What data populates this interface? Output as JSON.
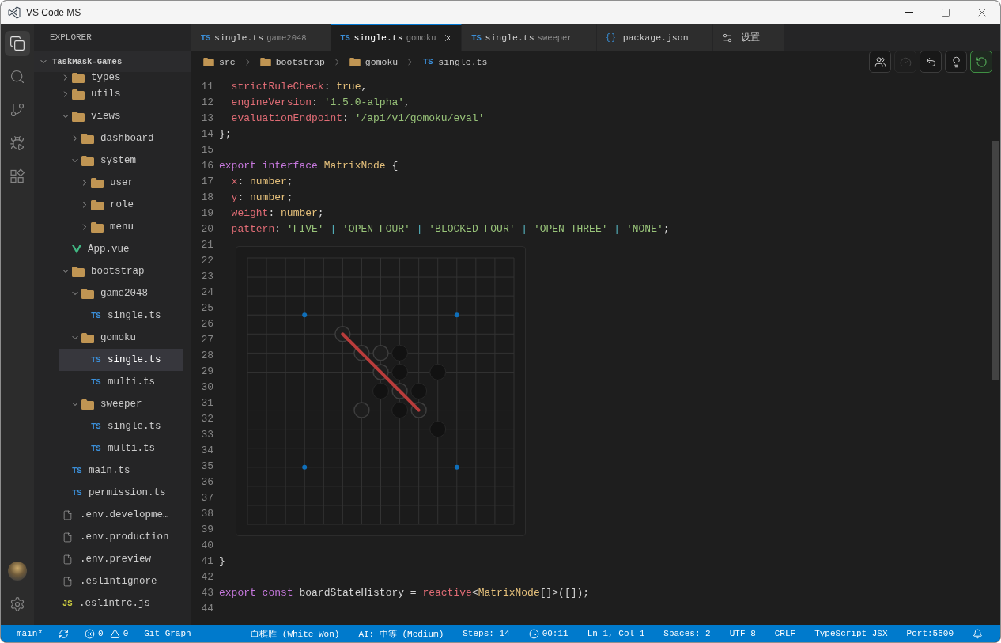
{
  "window": {
    "title": "VS Code MS"
  },
  "activity_bar": {
    "items": [
      {
        "kind": "explorer",
        "selected": true
      },
      {
        "kind": "search",
        "selected": false
      },
      {
        "kind": "source_control",
        "selected": false
      },
      {
        "kind": "run_debug",
        "selected": false
      },
      {
        "kind": "extensions",
        "selected": false
      }
    ],
    "bottom": [
      {
        "kind": "account"
      },
      {
        "kind": "settings"
      }
    ]
  },
  "explorer": {
    "title": "EXPLORER",
    "root": {
      "label": "TaskMask-Games",
      "expanded": true
    },
    "tree": [
      {
        "children": [
          {
            "label": "types",
            "kind": "folder",
            "expanded": false,
            "selected": false
          },
          {
            "label": "utils",
            "kind": "folder",
            "expanded": false,
            "selected": false
          },
          {
            "label": "views",
            "kind": "folder",
            "expanded": true,
            "selected": false,
            "children": [
              {
                "label": "dashboard",
                "kind": "folder",
                "expanded": false,
                "selected": false
              },
              {
                "label": "system",
                "kind": "folder",
                "expanded": true,
                "selected": false,
                "children": [
                  {
                    "label": "user",
                    "kind": "folder",
                    "expanded": false,
                    "selected": false
                  },
                  {
                    "label": "role",
                    "kind": "folder",
                    "expanded": false,
                    "selected": false
                  },
                  {
                    "label": "menu",
                    "kind": "folder",
                    "expanded": false,
                    "selected": false
                  }
                ]
              }
            ]
          },
          {
            "label": "App.vue",
            "kind": "vue",
            "selected": false
          },
          {
            "label": "bootstrap",
            "kind": "folder",
            "expanded": true,
            "selected": false,
            "children": [
              {
                "label": "game2048",
                "kind": "folder",
                "expanded": true,
                "selected": false,
                "children": [
                  {
                    "label": "single.ts",
                    "kind": "ts",
                    "badge": "TS",
                    "selected": false
                  }
                ]
              },
              {
                "label": "gomoku",
                "kind": "folder",
                "expanded": true,
                "selected": false,
                "children": [
                  {
                    "label": "single.ts",
                    "kind": "ts",
                    "badge": "TS",
                    "selected": true
                  },
                  {
                    "label": "multi.ts",
                    "kind": "ts",
                    "badge": "TS",
                    "selected": false
                  }
                ]
              },
              {
                "label": "sweeper",
                "kind": "folder",
                "expanded": true,
                "selected": false,
                "children": [
                  {
                    "label": "single.ts",
                    "kind": "ts",
                    "badge": "TS",
                    "selected": false
                  },
                  {
                    "label": "multi.ts",
                    "kind": "ts",
                    "badge": "TS",
                    "selected": false
                  }
                ]
              }
            ]
          },
          {
            "label": "main.ts",
            "kind": "ts",
            "badge": "TS",
            "selected": false
          },
          {
            "label": "permission.ts",
            "kind": "ts",
            "badge": "TS",
            "selected": false
          }
        ]
      },
      {
        "label": ".env.developme…",
        "kind": "file",
        "selected": false
      },
      {
        "label": ".env.production",
        "kind": "file",
        "selected": false
      },
      {
        "label": ".env.preview",
        "kind": "file",
        "selected": false
      },
      {
        "label": ".eslintignore",
        "kind": "file",
        "selected": false
      },
      {
        "label": ".eslintrc.js",
        "kind": "js",
        "badge": "JS",
        "selected": false
      }
    ]
  },
  "tabs": [
    {
      "kind": "ts",
      "badge": "TS",
      "label": "single.ts",
      "description": "game2048",
      "selected": false
    },
    {
      "kind": "ts",
      "badge": "TS",
      "label": "single.ts",
      "description": "gomoku",
      "selected": true
    },
    {
      "kind": "ts",
      "badge": "TS",
      "label": "single.ts",
      "description": "sweeper",
      "selected": false
    },
    {
      "kind": "json",
      "label": "package.json",
      "selected": false
    },
    {
      "kind": "settings",
      "label": "设置",
      "selected": false
    }
  ],
  "breadcrumb": [
    {
      "kind": "folder",
      "label": "src"
    },
    {
      "kind": "folder",
      "label": "bootstrap"
    },
    {
      "kind": "folder",
      "label": "gomoku"
    },
    {
      "kind": "ts",
      "badge": "TS",
      "label": "single.ts"
    }
  ],
  "toolbar": [
    {
      "kind": "players",
      "disabled": false,
      "active": false
    },
    {
      "kind": "speed",
      "disabled": true,
      "active": false
    },
    {
      "kind": "undo",
      "disabled": false,
      "active": false
    },
    {
      "kind": "hint",
      "disabled": false,
      "active": false
    },
    {
      "kind": "restart",
      "disabled": false,
      "active": true
    }
  ],
  "editor": {
    "lines": [
      {
        "number": "11",
        "tokens": [
          {
            "text": "  strictRuleCheck",
            "kind": "property"
          },
          {
            "text": ": ",
            "kind": "punct"
          },
          {
            "text": "true",
            "kind": "boolean"
          },
          {
            "text": ",",
            "kind": "punct"
          }
        ]
      },
      {
        "number": "12",
        "tokens": [
          {
            "text": "  engineVersion",
            "kind": "property"
          },
          {
            "text": ": ",
            "kind": "punct"
          },
          {
            "text": "'1.5.0-alpha'",
            "kind": "string"
          },
          {
            "text": ",",
            "kind": "punct"
          }
        ]
      },
      {
        "number": "13",
        "tokens": [
          {
            "text": "  evaluationEndpoint",
            "kind": "property"
          },
          {
            "text": ": ",
            "kind": "punct"
          },
          {
            "text": "'/api/v1/gomoku/eval'",
            "kind": "string"
          }
        ]
      },
      {
        "number": "14",
        "tokens": [
          {
            "text": "};",
            "kind": "punct"
          }
        ]
      },
      {
        "number": "15"
      },
      {
        "number": "16",
        "tokens": [
          {
            "text": "export interface",
            "kind": "keyword"
          },
          {
            "text": " MatrixNode",
            "kind": "type"
          },
          {
            "text": " {",
            "kind": "punct"
          }
        ]
      },
      {
        "number": "17",
        "tokens": [
          {
            "text": "  x",
            "kind": "property"
          },
          {
            "text": ": ",
            "kind": "punct"
          },
          {
            "text": "number",
            "kind": "type"
          },
          {
            "text": ";",
            "kind": "punct"
          }
        ]
      },
      {
        "number": "18",
        "tokens": [
          {
            "text": "  y",
            "kind": "property"
          },
          {
            "text": ": ",
            "kind": "punct"
          },
          {
            "text": "number",
            "kind": "type"
          },
          {
            "text": ";",
            "kind": "punct"
          }
        ]
      },
      {
        "number": "19",
        "tokens": [
          {
            "text": "  weight",
            "kind": "property"
          },
          {
            "text": ": ",
            "kind": "punct"
          },
          {
            "text": "number",
            "kind": "type"
          },
          {
            "text": ";",
            "kind": "punct"
          }
        ]
      },
      {
        "number": "20",
        "tokens": [
          {
            "text": "  pattern",
            "kind": "property"
          },
          {
            "text": ": ",
            "kind": "punct"
          },
          {
            "text": "'FIVE'",
            "kind": "string"
          },
          {
            "text": " | ",
            "kind": "operator"
          },
          {
            "text": "'OPEN_FOUR'",
            "kind": "string"
          },
          {
            "text": " | ",
            "kind": "operator"
          },
          {
            "text": "'BLOCKED_FOUR'",
            "kind": "string"
          },
          {
            "text": " | ",
            "kind": "operator"
          },
          {
            "text": "'OPEN_THREE'",
            "kind": "string"
          },
          {
            "text": " | ",
            "kind": "operator"
          },
          {
            "text": "'NONE'",
            "kind": "string"
          },
          {
            "text": ";",
            "kind": "punct"
          }
        ]
      },
      {
        "number": "21",
        "board": {
          "rows": [
            [
              {
                "kind": "empty"
              },
              {
                "kind": "empty"
              },
              {
                "kind": "empty"
              },
              {
                "kind": "empty"
              },
              {
                "kind": "empty"
              },
              {
                "kind": "empty"
              },
              {
                "kind": "empty"
              },
              {
                "kind": "empty"
              },
              {
                "kind": "empty"
              },
              {
                "kind": "empty"
              },
              {
                "kind": "empty"
              },
              {
                "kind": "empty"
              },
              {
                "kind": "empty"
              },
              {
                "kind": "empty"
              },
              {
                "kind": "empty"
              }
            ],
            [
              {
                "kind": "empty"
              },
              {
                "kind": "empty"
              },
              {
                "kind": "empty"
              },
              {
                "kind": "empty"
              },
              {
                "kind": "empty"
              },
              {
                "kind": "empty"
              },
              {
                "kind": "empty"
              },
              {
                "kind": "empty"
              },
              {
                "kind": "empty"
              },
              {
                "kind": "empty"
              },
              {
                "kind": "empty"
              },
              {
                "kind": "empty"
              },
              {
                "kind": "empty"
              },
              {
                "kind": "empty"
              },
              {
                "kind": "empty"
              }
            ],
            [
              {
                "kind": "empty"
              },
              {
                "kind": "empty"
              },
              {
                "kind": "empty"
              },
              {
                "kind": "empty"
              },
              {
                "kind": "empty"
              },
              {
                "kind": "empty"
              },
              {
                "kind": "empty"
              },
              {
                "kind": "empty"
              },
              {
                "kind": "empty"
              },
              {
                "kind": "empty"
              },
              {
                "kind": "empty"
              },
              {
                "kind": "empty"
              },
              {
                "kind": "empty"
              },
              {
                "kind": "empty"
              },
              {
                "kind": "empty"
              }
            ],
            [
              {
                "kind": "empty"
              },
              {
                "kind": "empty"
              },
              {
                "kind": "empty"
              },
              {
                "kind": "empty"
              },
              {
                "kind": "empty"
              },
              {
                "kind": "empty"
              },
              {
                "kind": "empty"
              },
              {
                "kind": "empty"
              },
              {
                "kind": "empty"
              },
              {
                "kind": "empty"
              },
              {
                "kind": "empty"
              },
              {
                "kind": "empty"
              },
              {
                "kind": "empty"
              },
              {
                "kind": "empty"
              },
              {
                "kind": "empty"
              }
            ],
            [
              {
                "kind": "empty"
              },
              {
                "kind": "empty"
              },
              {
                "kind": "empty"
              },
              {
                "kind": "empty"
              },
              {
                "kind": "empty"
              },
              {
                "kind": "white",
                "winning": true
              },
              {
                "kind": "empty"
              },
              {
                "kind": "empty"
              },
              {
                "kind": "empty"
              },
              {
                "kind": "empty"
              },
              {
                "kind": "empty"
              },
              {
                "kind": "empty"
              },
              {
                "kind": "empty"
              },
              {
                "kind": "empty"
              },
              {
                "kind": "empty"
              }
            ],
            [
              {
                "kind": "empty"
              },
              {
                "kind": "empty"
              },
              {
                "kind": "empty"
              },
              {
                "kind": "empty"
              },
              {
                "kind": "empty"
              },
              {
                "kind": "empty"
              },
              {
                "kind": "white",
                "winning": true
              },
              {
                "kind": "white",
                "winning": false
              },
              {
                "kind": "black",
                "winning": false
              },
              {
                "kind": "empty"
              },
              {
                "kind": "empty"
              },
              {
                "kind": "empty"
              },
              {
                "kind": "empty"
              },
              {
                "kind": "empty"
              },
              {
                "kind": "empty"
              }
            ],
            [
              {
                "kind": "empty"
              },
              {
                "kind": "empty"
              },
              {
                "kind": "empty"
              },
              {
                "kind": "empty"
              },
              {
                "kind": "empty"
              },
              {
                "kind": "empty"
              },
              {
                "kind": "empty"
              },
              {
                "kind": "white",
                "winning": true
              },
              {
                "kind": "black",
                "winning": false
              },
              {
                "kind": "empty"
              },
              {
                "kind": "black",
                "winning": false
              },
              {
                "kind": "empty"
              },
              {
                "kind": "empty"
              },
              {
                "kind": "empty"
              },
              {
                "kind": "empty"
              }
            ],
            [
              {
                "kind": "empty"
              },
              {
                "kind": "empty"
              },
              {
                "kind": "empty"
              },
              {
                "kind": "empty"
              },
              {
                "kind": "empty"
              },
              {
                "kind": "empty"
              },
              {
                "kind": "empty"
              },
              {
                "kind": "black",
                "winning": false
              },
              {
                "kind": "white",
                "winning": true
              },
              {
                "kind": "black",
                "winning": false
              },
              {
                "kind": "empty"
              },
              {
                "kind": "empty"
              },
              {
                "kind": "empty"
              },
              {
                "kind": "empty"
              },
              {
                "kind": "empty"
              }
            ],
            [
              {
                "kind": "empty"
              },
              {
                "kind": "empty"
              },
              {
                "kind": "empty"
              },
              {
                "kind": "empty"
              },
              {
                "kind": "empty"
              },
              {
                "kind": "empty"
              },
              {
                "kind": "white",
                "winning": false
              },
              {
                "kind": "empty"
              },
              {
                "kind": "black",
                "winning": false
              },
              {
                "kind": "white",
                "winning": true
              },
              {
                "kind": "empty"
              },
              {
                "kind": "empty"
              },
              {
                "kind": "empty"
              },
              {
                "kind": "empty"
              },
              {
                "kind": "empty"
              }
            ],
            [
              {
                "kind": "empty"
              },
              {
                "kind": "empty"
              },
              {
                "kind": "empty"
              },
              {
                "kind": "empty"
              },
              {
                "kind": "empty"
              },
              {
                "kind": "empty"
              },
              {
                "kind": "empty"
              },
              {
                "kind": "empty"
              },
              {
                "kind": "empty"
              },
              {
                "kind": "empty"
              },
              {
                "kind": "black",
                "winning": false
              },
              {
                "kind": "empty"
              },
              {
                "kind": "empty"
              },
              {
                "kind": "empty"
              },
              {
                "kind": "empty"
              }
            ],
            [
              {
                "kind": "empty"
              },
              {
                "kind": "empty"
              },
              {
                "kind": "empty"
              },
              {
                "kind": "empty"
              },
              {
                "kind": "empty"
              },
              {
                "kind": "empty"
              },
              {
                "kind": "empty"
              },
              {
                "kind": "empty"
              },
              {
                "kind": "empty"
              },
              {
                "kind": "empty"
              },
              {
                "kind": "empty"
              },
              {
                "kind": "empty"
              },
              {
                "kind": "empty"
              },
              {
                "kind": "empty"
              },
              {
                "kind": "empty"
              }
            ],
            [
              {
                "kind": "empty"
              },
              {
                "kind": "empty"
              },
              {
                "kind": "empty"
              },
              {
                "kind": "empty"
              },
              {
                "kind": "empty"
              },
              {
                "kind": "empty"
              },
              {
                "kind": "empty"
              },
              {
                "kind": "empty"
              },
              {
                "kind": "empty"
              },
              {
                "kind": "empty"
              },
              {
                "kind": "empty"
              },
              {
                "kind": "empty"
              },
              {
                "kind": "empty"
              },
              {
                "kind": "empty"
              },
              {
                "kind": "empty"
              }
            ],
            [
              {
                "kind": "empty"
              },
              {
                "kind": "empty"
              },
              {
                "kind": "empty"
              },
              {
                "kind": "empty"
              },
              {
                "kind": "empty"
              },
              {
                "kind": "empty"
              },
              {
                "kind": "empty"
              },
              {
                "kind": "empty"
              },
              {
                "kind": "empty"
              },
              {
                "kind": "empty"
              },
              {
                "kind": "empty"
              },
              {
                "kind": "empty"
              },
              {
                "kind": "empty"
              },
              {
                "kind": "empty"
              },
              {
                "kind": "empty"
              }
            ],
            [
              {
                "kind": "empty"
              },
              {
                "kind": "empty"
              },
              {
                "kind": "empty"
              },
              {
                "kind": "empty"
              },
              {
                "kind": "empty"
              },
              {
                "kind": "empty"
              },
              {
                "kind": "empty"
              },
              {
                "kind": "empty"
              },
              {
                "kind": "empty"
              },
              {
                "kind": "empty"
              },
              {
                "kind": "empty"
              },
              {
                "kind": "empty"
              },
              {
                "kind": "empty"
              },
              {
                "kind": "empty"
              },
              {
                "kind": "empty"
              }
            ],
            [
              {
                "kind": "empty"
              },
              {
                "kind": "empty"
              },
              {
                "kind": "empty"
              },
              {
                "kind": "empty"
              },
              {
                "kind": "empty"
              },
              {
                "kind": "empty"
              },
              {
                "kind": "empty"
              },
              {
                "kind": "empty"
              },
              {
                "kind": "empty"
              },
              {
                "kind": "empty"
              },
              {
                "kind": "empty"
              },
              {
                "kind": "empty"
              },
              {
                "kind": "empty"
              },
              {
                "kind": "empty"
              },
              {
                "kind": "empty"
              }
            ]
          ]
        }
      },
      {
        "number": "22"
      },
      {
        "number": "23"
      },
      {
        "number": "24"
      },
      {
        "number": "25"
      },
      {
        "number": "26"
      },
      {
        "number": "27"
      },
      {
        "number": "28"
      },
      {
        "number": "29"
      },
      {
        "number": "30"
      },
      {
        "number": "31"
      },
      {
        "number": "32"
      },
      {
        "number": "33"
      },
      {
        "number": "34"
      },
      {
        "number": "35"
      },
      {
        "number": "36"
      },
      {
        "number": "37"
      },
      {
        "number": "38"
      },
      {
        "number": "39"
      },
      {
        "number": "40"
      },
      {
        "number": "41",
        "tokens": [
          {
            "text": "}",
            "kind": "punct"
          }
        ]
      },
      {
        "number": "42"
      },
      {
        "number": "43",
        "tokens": [
          {
            "text": "export const",
            "kind": "keyword"
          },
          {
            "text": " boardStateHistory = ",
            "kind": "ident"
          },
          {
            "text": "reactive",
            "kind": "function"
          },
          {
            "text": "<",
            "kind": "punct"
          },
          {
            "text": "MatrixNode",
            "kind": "type"
          },
          {
            "text": "[]>([]);",
            "kind": "punct"
          }
        ]
      },
      {
        "number": "44"
      }
    ]
  },
  "status_bar": {
    "left": [
      {
        "kind": "text",
        "text": "main*"
      },
      {
        "kind": "sync"
      },
      {
        "kind": "problems",
        "errors": "0",
        "warnings": "0"
      },
      {
        "kind": "text",
        "text": "Git Graph"
      }
    ],
    "right": [
      {
        "kind": "text",
        "text": "白棋胜 (White Won)"
      },
      {
        "kind": "text",
        "text": "AI: 中等 (Medium)"
      },
      {
        "kind": "text",
        "text": "Steps: 14"
      },
      {
        "kind": "timer",
        "text": "00:11"
      },
      {
        "kind": "text",
        "text": "Ln 1, Col 1"
      },
      {
        "kind": "text",
        "text": "Spaces: 2"
      },
      {
        "kind": "text",
        "text": "UTF-8"
      },
      {
        "kind": "text",
        "text": "CRLF"
      },
      {
        "kind": "text",
        "text": "TypeScript JSX"
      },
      {
        "kind": "text",
        "text": "Port:5500"
      },
      {
        "kind": "bell"
      }
    ]
  }
}
